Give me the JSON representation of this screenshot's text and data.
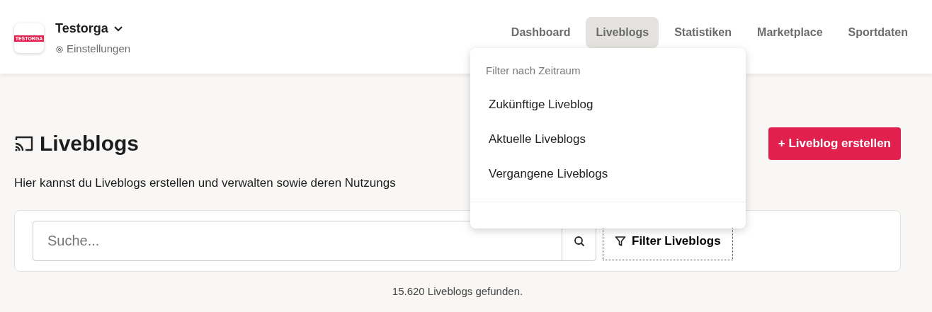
{
  "org": {
    "logo_text": "TESTORGA",
    "name": "Testorga",
    "settings": "Einstellungen"
  },
  "nav": [
    {
      "label": "Dashboard",
      "selected": false
    },
    {
      "label": "Liveblogs",
      "selected": true
    },
    {
      "label": "Statistiken",
      "selected": false
    },
    {
      "label": "Marketplace",
      "selected": false
    },
    {
      "label": "Sportdaten",
      "selected": false
    }
  ],
  "dropdown": {
    "sections": [
      {
        "header": "Filter nach Zeitraum",
        "items": [
          "Zukünftige Liveblog",
          "Aktuelle Liveblogs",
          "Vergangene Liveblogs"
        ]
      }
    ]
  },
  "page": {
    "title": "Liveblogs",
    "description": "Hier kannst du Liveblogs erstellen und verwalten sowie deren Nutzungs",
    "create_button": "+ Liveblog erstellen"
  },
  "search": {
    "placeholder": "Suche..."
  },
  "filter_button": "Filter Liveblogs",
  "result_count": "15.620 Liveblogs gefunden."
}
